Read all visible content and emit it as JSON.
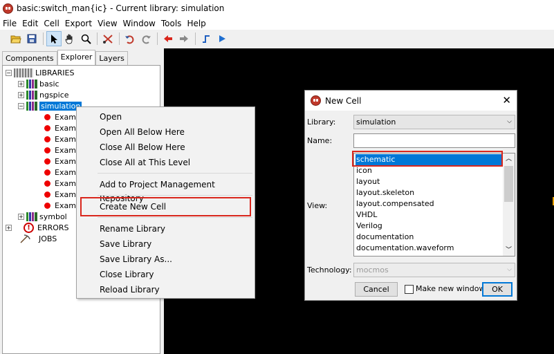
{
  "window": {
    "title": "basic:switch_man{ic} - Current library: simulation"
  },
  "menu": [
    "File",
    "Edit",
    "Cell",
    "Export",
    "View",
    "Window",
    "Tools",
    "Help"
  ],
  "toolbar": {
    "icons": [
      "open-folder-icon",
      "save-icon",
      "select-arrow-icon",
      "pan-hand-icon",
      "zoom-icon",
      "cut-tools-icon",
      "undo-icon",
      "redo-icon",
      "back-red-icon",
      "forward-gray-icon",
      "wire-icon",
      "play-icon"
    ]
  },
  "left_panel": {
    "tabs": [
      "Components",
      "Explorer",
      "Layers"
    ],
    "active_tab": "Explorer",
    "tree": {
      "root": "LIBRARIES",
      "libraries": [
        "basic",
        "ngspice",
        "simulation",
        "symbol"
      ],
      "selected": "simulation",
      "children": [
        "Examp",
        "Examp",
        "Examp",
        "Examp",
        "Examp",
        "Examp",
        "Examp",
        "Examp",
        "Examp"
      ],
      "errors": "ERRORS",
      "jobs": "JOBS"
    }
  },
  "context_menu": {
    "items": [
      "Open",
      "Open All Below Here",
      "Close All Below Here",
      "Close All at This Level",
      "Add to Project Management Repository",
      "Create New Cell",
      "Rename Library",
      "Save Library",
      "Save Library As...",
      "Close Library",
      "Reload Library"
    ],
    "highlighted": "Create New Cell"
  },
  "dialog": {
    "title": "New Cell",
    "library_label": "Library:",
    "library_value": "simulation",
    "name_label": "Name:",
    "name_value": "",
    "view_label": "View:",
    "views": [
      "schematic",
      "icon",
      "layout",
      "layout.skeleton",
      "layout.compensated",
      "VHDL",
      "Verilog",
      "documentation",
      "documentation.waveform"
    ],
    "selected_view": "schematic",
    "technology_label": "Technology:",
    "technology_value": "mocmos",
    "cancel_label": "Cancel",
    "checkbox_label": "Make new window",
    "checkbox_checked": false,
    "ok_label": "OK"
  },
  "colors": {
    "selection": "#0078d7",
    "highlight_box": "#d9261c",
    "canvas": "#000000"
  }
}
